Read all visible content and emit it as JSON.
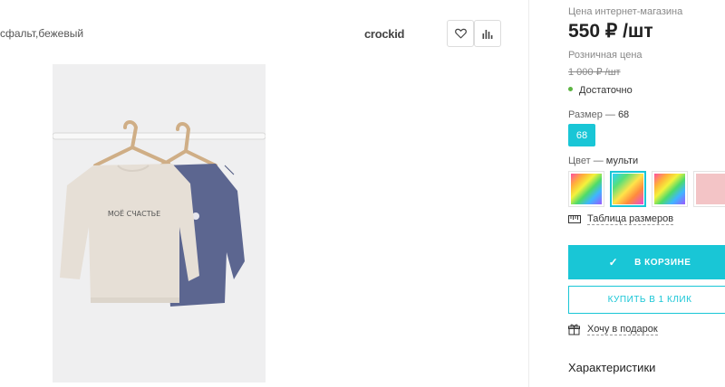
{
  "product": {
    "subtitle": "сфальт,бежевый",
    "brand_name": "crockid",
    "favorite_icon": "heart-icon",
    "compare_icon": "bar-chart-icon"
  },
  "purchase": {
    "online_price_label": "Цена интернет-магазина",
    "price": "550 ₽ /шт",
    "retail_label": "Розничная цена",
    "retail_price": "1 000 ₽ /шт",
    "stock": "Достаточно",
    "stock_color": "#5db543",
    "size_label": "Размер",
    "size_dash": "—",
    "size_value": "68",
    "size_options": [
      "68"
    ],
    "color_label": "Цвет",
    "color_dash": "—",
    "color_value": "мульти",
    "size_table_link": "Таблица размеров",
    "in_cart_button": "В КОРЗИНЕ",
    "one_click_button": "КУПИТЬ В 1 КЛИК",
    "gift_link": "Хочу в подарок",
    "specs_heading": "Характеристики",
    "accent_color": "#19c6d6"
  },
  "shirt_print": "МОЁ СЧАСТЬЕ"
}
